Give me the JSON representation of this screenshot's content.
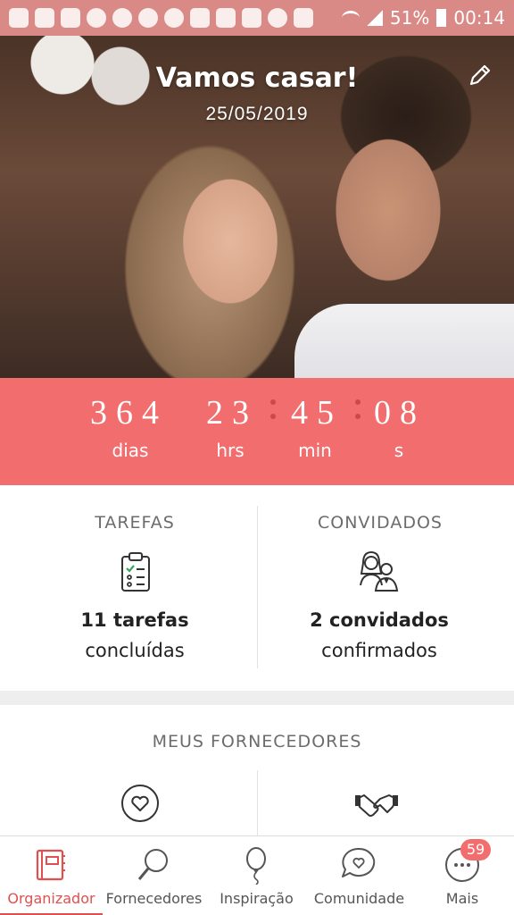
{
  "status_bar": {
    "battery": "51%",
    "time": "00:14"
  },
  "hero": {
    "title": "Vamos casar!",
    "date": "25/05/2019"
  },
  "countdown": {
    "days": "364",
    "hours": "23",
    "minutes": "45",
    "seconds": "08",
    "days_label": "dias",
    "hours_label": "hrs",
    "minutes_label": "min",
    "seconds_label": "s"
  },
  "tasks": {
    "title": "TAREFAS",
    "count_text": "11 tarefas",
    "status_text": "concluídas"
  },
  "guests": {
    "title": "CONVIDADOS",
    "count_text": "2 convidados",
    "status_text": "confirmados"
  },
  "vendors": {
    "title": "MEUS FORNECEDORES"
  },
  "bottom_nav": {
    "items": [
      {
        "label": "Organizador",
        "icon": "planner-book-icon",
        "active": true
      },
      {
        "label": "Fornecedores",
        "icon": "magnifier-icon",
        "active": false
      },
      {
        "label": "Inspiração",
        "icon": "balloon-icon",
        "active": false
      },
      {
        "label": "Comunidade",
        "icon": "chat-heart-icon",
        "active": false
      },
      {
        "label": "Mais",
        "icon": "more-dots-icon",
        "active": false
      }
    ],
    "more_badge": "59"
  },
  "colors": {
    "accent": "#f26d6d",
    "active_nav": "#e0504f",
    "status_bar": "#d98a86"
  }
}
